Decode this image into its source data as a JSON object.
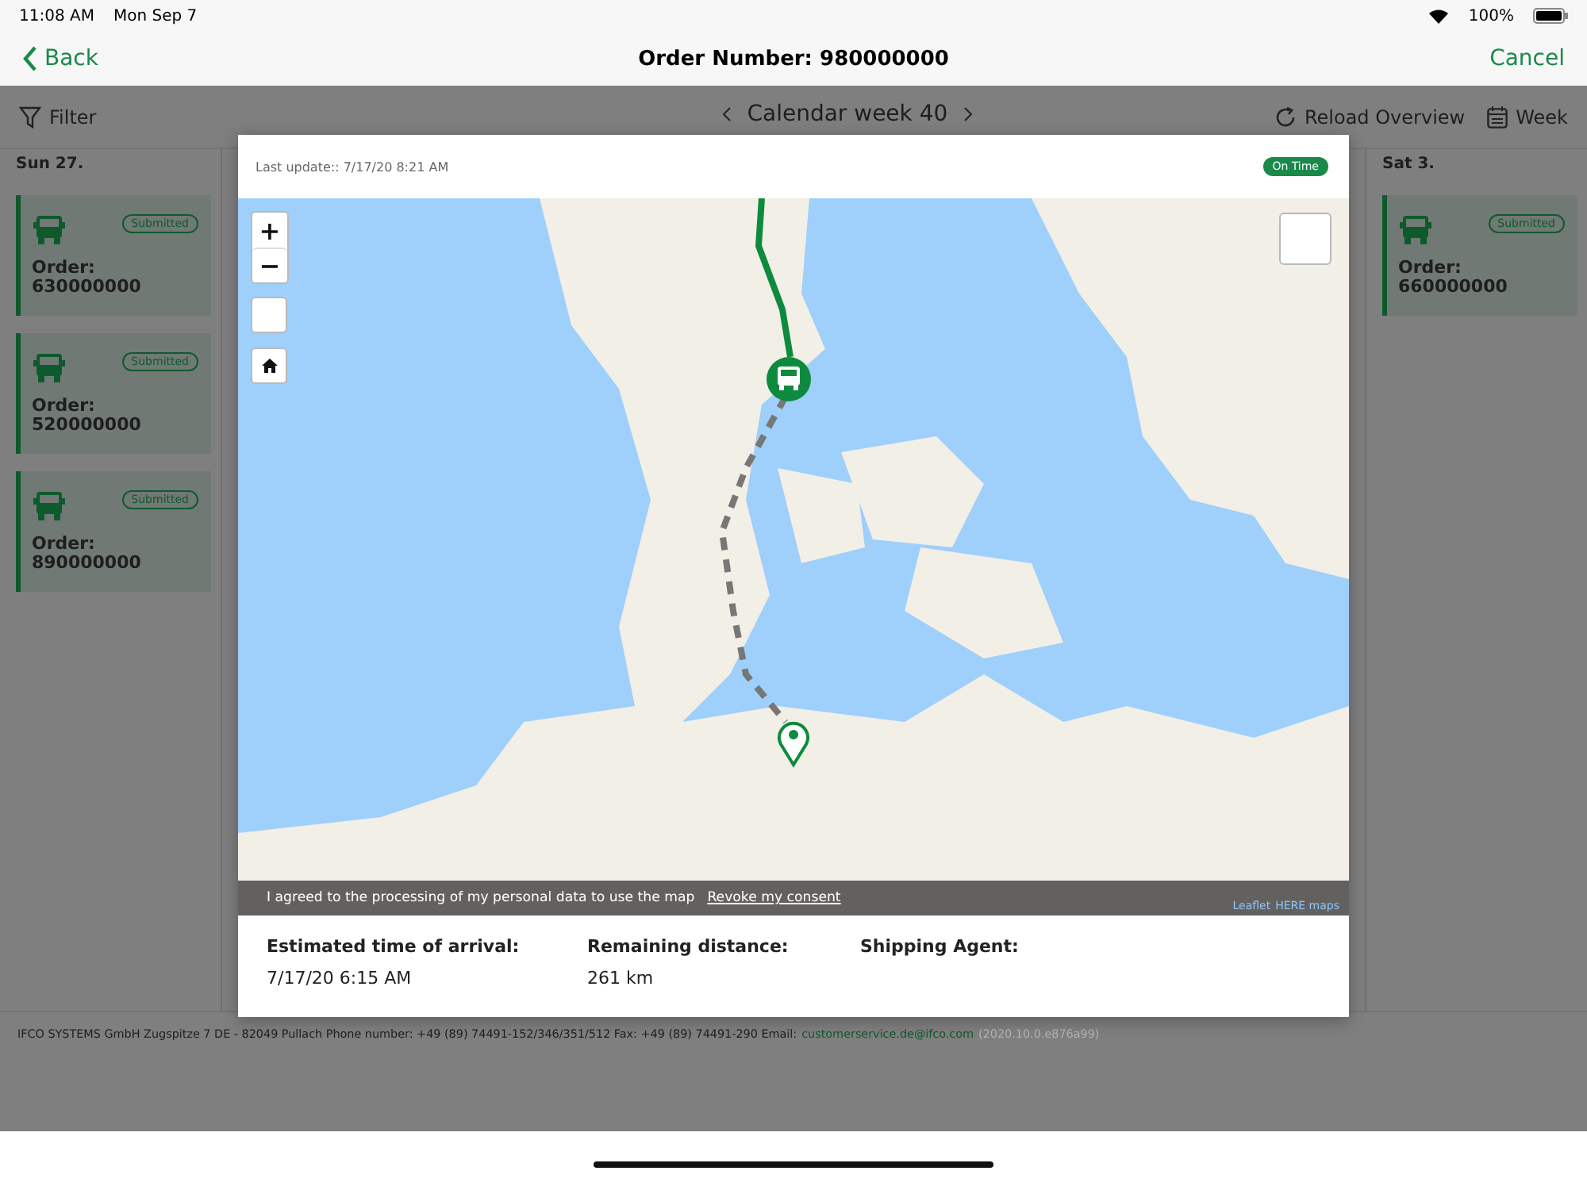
{
  "status_bar": {
    "time": "11:08 AM",
    "date": "Mon Sep 7",
    "battery": "100%"
  },
  "nav": {
    "back": "Back",
    "title": "Order Number: 980000000",
    "cancel": "Cancel"
  },
  "toolbar": {
    "filter": "Filter",
    "calendar_week": "Calendar week 40",
    "reload": "Reload Overview",
    "view": "Week"
  },
  "columns": [
    {
      "day": "Sun 27.",
      "orders": [
        {
          "label": "Order:",
          "number": "630000000",
          "status": {
            "label": "Submitted",
            "kind": "submitted"
          }
        },
        {
          "label": "Order:",
          "number": "520000000",
          "status": {
            "label": "Submitted",
            "kind": "submitted"
          }
        },
        {
          "label": "Order:",
          "number": "890000000",
          "status": {
            "label": "Submitted",
            "kind": "submitted"
          }
        }
      ]
    },
    {
      "day": "Sat 3.",
      "orders": [
        {
          "label": "Order:",
          "number": "660000000",
          "status": {
            "label": "Submitted",
            "kind": "submitted"
          }
        }
      ]
    }
  ],
  "footer": {
    "text": "IFCO SYSTEMS GmbH Zugspitze 7 DE - 82049 Pullach Phone number: +49 (89) 74491-152/346/351/512 Fax: +49 (89) 74491-290 Email:",
    "email": "customerservice.de@ifco.com",
    "version": "(2020.10.0.e876a99)"
  },
  "modal": {
    "last_update": "Last update:: 7/17/20 8:21 AM",
    "status": {
      "label": "On Time",
      "kind": "on_time"
    },
    "map": {
      "zoom_in": "+",
      "zoom_out": "−",
      "consent": {
        "text": "I agreed to the processing of my personal data to use the map",
        "link": "Revoke my consent"
      },
      "attribution": [
        "Leaflet",
        "HERE maps"
      ]
    },
    "details": [
      {
        "label": "Estimated time of arrival:",
        "value": "7/17/20 6:15 AM"
      },
      {
        "label": "Remaining distance:",
        "value": "261 km"
      },
      {
        "label": "Shipping Agent:"
      }
    ]
  }
}
